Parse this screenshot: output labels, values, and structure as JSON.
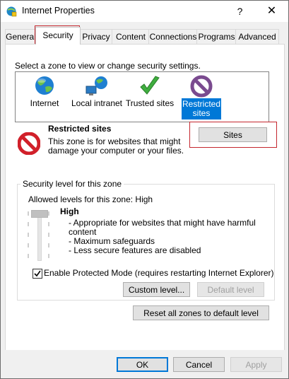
{
  "window": {
    "title": "Internet Properties",
    "help_glyph": "?",
    "close_glyph": "✕"
  },
  "tabs": [
    {
      "label": "General"
    },
    {
      "label": "Security"
    },
    {
      "label": "Privacy"
    },
    {
      "label": "Content"
    },
    {
      "label": "Connections"
    },
    {
      "label": "Programs"
    },
    {
      "label": "Advanced"
    }
  ],
  "active_tab": "Security",
  "security": {
    "instruction": "Select a zone to view or change security settings.",
    "zones": [
      {
        "label_line1": "Internet",
        "label_line2": "",
        "icon": "globe-icon",
        "selected": false
      },
      {
        "label_line1": "Local intranet",
        "label_line2": "",
        "icon": "intranet-icon",
        "selected": false
      },
      {
        "label_line1": "Trusted sites",
        "label_line2": "",
        "icon": "checkmark-icon",
        "selected": false
      },
      {
        "label_line1": "Restricted",
        "label_line2": "sites",
        "icon": "restricted-icon",
        "selected": true
      }
    ],
    "zone_title": "Restricted sites",
    "zone_description_line1": "This zone is for websites that might",
    "zone_description_line2": "damage your computer or your files.",
    "sites_button": "Sites",
    "level_group_title": "Security level for this zone",
    "allowed_levels": "Allowed levels for this zone: High",
    "level_name": "High",
    "level_bullets": [
      "- Appropriate for websites that might have harmful",
      "content",
      "- Maximum safeguards",
      "- Less secure features are disabled"
    ],
    "protected_mode_label": "Enable Protected Mode (requires restarting Internet Explorer)",
    "protected_mode_checked": true,
    "custom_level_button": "Custom level...",
    "default_level_button": "Default level",
    "reset_all_button": "Reset all zones to default level"
  },
  "footer": {
    "ok": "OK",
    "cancel": "Cancel",
    "apply": "Apply"
  },
  "colors": {
    "accent": "#0078d7",
    "highlight_box": "#c4262e",
    "restricted_red": "#d1202a"
  }
}
